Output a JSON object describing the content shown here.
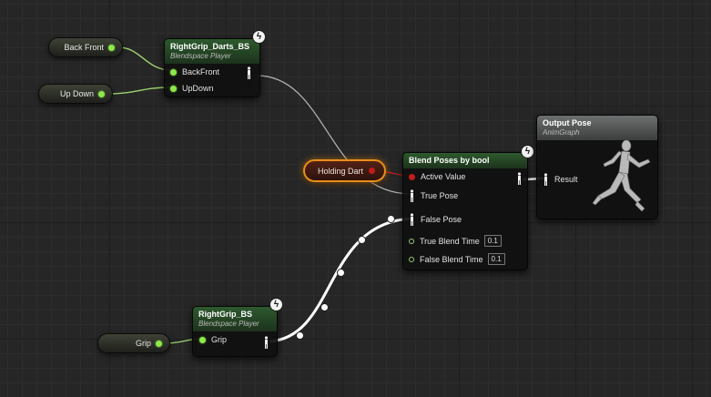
{
  "variables": {
    "back_front": "Back Front",
    "up_down": "Up Down",
    "grip": "Grip",
    "holding_dart": "Holding Dart"
  },
  "darts_bs": {
    "title": "RightGrip_Darts_BS",
    "subtitle": "Blendspace Player",
    "pins": [
      "BackFront",
      "UpDown"
    ]
  },
  "grip_bs": {
    "title": "RightGrip_BS",
    "subtitle": "Blendspace Player",
    "pins": [
      "Grip"
    ]
  },
  "blend": {
    "title": "Blend Poses by bool",
    "active_value": "Active Value",
    "true_pose": "True Pose",
    "false_pose": "False Pose",
    "true_blend_time": "True Blend Time",
    "true_blend_value": "0.1",
    "false_blend_time": "False Blend Time",
    "false_blend_value": "0.1"
  },
  "output": {
    "title": "Output Pose",
    "subtitle": "AnimGraph",
    "result": "Result"
  },
  "icons": {
    "bolt": "lightning-bolt-icon",
    "pose": "pose-figure-icon",
    "mannequin": "mannequin-icon"
  },
  "colors": {
    "float_pin": "#8de84a",
    "bool_pin": "#c21c1c",
    "blendspace_header": "#2e5a2e",
    "output_header": "#6d7070",
    "selection": "#e88d1a"
  }
}
